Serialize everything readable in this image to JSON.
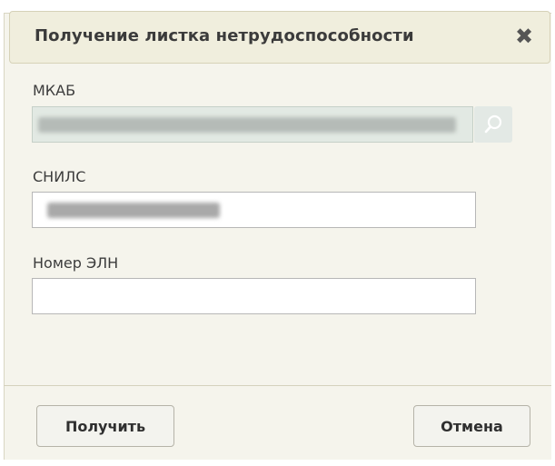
{
  "dialog": {
    "title": "Получение листка нетрудоспособности",
    "close_icon": "close-icon",
    "close_glyph": "✖"
  },
  "fields": {
    "mkab": {
      "label": "МКАБ",
      "value": "",
      "disabled": true,
      "search_icon": "search-icon"
    },
    "snils": {
      "label": "СНИЛС",
      "value": ""
    },
    "eln": {
      "label": "Номер ЭЛН",
      "value": ""
    }
  },
  "buttons": {
    "get_label": "Получить",
    "cancel_label": "Отмена"
  },
  "colors": {
    "dialog_bg": "#f5f4ec",
    "header_bg": "#f0eedd",
    "disabled_input_bg": "#e2e9e3"
  }
}
